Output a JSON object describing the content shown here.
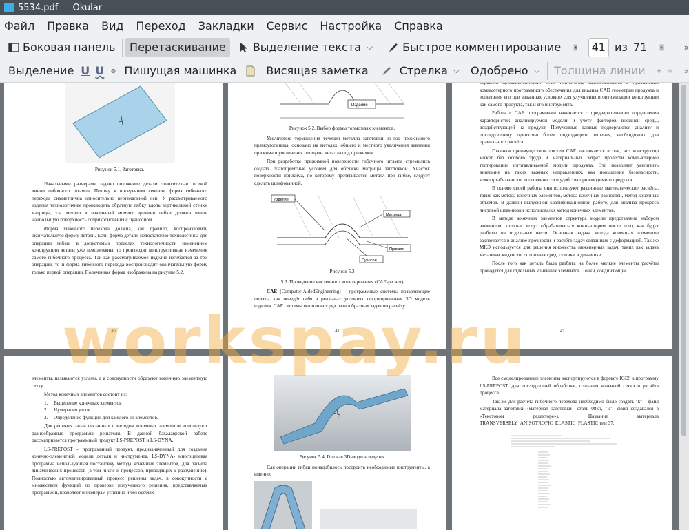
{
  "window": {
    "title": "5534.pdf  — Okular"
  },
  "menu": [
    "Файл",
    "Правка",
    "Вид",
    "Переход",
    "Закладки",
    "Сервис",
    "Настройка",
    "Справка"
  ],
  "toolbar1": {
    "sidebar": "Боковая панель",
    "drag": "Перетаскивание",
    "select_text": "Выделение текста",
    "quick_comment": "Быстрое комментирование",
    "page_current": "41",
    "page_of": "из",
    "page_total": "71"
  },
  "toolbar2": {
    "highlight": "Выделение",
    "typewriter": "Пишущая машинка",
    "sticky_note": "Висящая заметка",
    "arrow": "Стрелка",
    "approved": "Одобрено",
    "line_width": "Толщина линии"
  },
  "watermark": "worksрay.ru",
  "pages": {
    "p40": {
      "caption": "Рисунок 5.1. Заготовка.",
      "paragraphs": [
        "Начальными размерами задано положение детали относительно осевой линии гибочного штампа. Потому в поперечном сечении форма гибочного перехода симметрична относительно вертикальной оси. У рассматриваемого изделия технологичнее производить обратную гибку вдоль вертикальной стенки матрицы, т.к. металл в начальный момент времени гибки должен иметь наибольшую поверхность соприкосновения с пуансоном.",
        "Форма гибочного перехода должна, как правило, воспроизводить окончательную форму детали. Если форма детали недостаточно технологична для операции гибки, в допустимых пределах технологичности изменением конструкции детали уже невозможны, то производят конструктивные изменения самого гибочного процесса. Так как рассматриваемое изделие изгибается за три операции, то и форма гибочного перехода воспроизводит окончательную форму только первой операции. Полученная форма изображена на рисунке 5.2."
      ],
      "number": "40"
    },
    "p41": {
      "label_top": "Изделие",
      "caption1": "Рисунок 5.2. Выбор формы тормозных элементов.",
      "paragraphs": [
        "Увеличение торможения течения металла заготовки из-под прижимного прямоугольника, основано на методах: общего и местного увеличения давления прижима и увеличения площади металла под прижимом.",
        "При разработке прижимной поверхности гибочного штампа стремились создать благоприятные условия для обтяжки матрицы заготовкой. Участок поверхности прижима, по которому протягивается металл при гибке, следует сделать шлифованной."
      ],
      "labels": {
        "a": "Изделие",
        "b": "Матрица",
        "c": "Прижим",
        "d": "Пуансон"
      },
      "caption2": "Рисунок 5.3",
      "heading": "5.3. Проведение численного моделирования (CAE-расчет)",
      "cae_term": "CAE",
      "cae_text": "(Computer-AidedEngineering) – программные системы позволяющие понять, как поведёт себя в реальных условиях сформированная 3D модель изделия. CAE системы выполняют ряд разнообразных задач по расчёту",
      "number": "41"
    },
    "p42": {
      "paragraphs": [
        "отраслях промышленности. CAE технология, заключающаяся в применении компьютерного программного обеспечения для анализа CAD геометрии продукта и испытания его при заданных условиях для улучшения и оптимизации конструкции как самого продукта, так и его инструмента.",
        "Работа с CAE программами начинается с предварительного определения характеристик анализируемой модели и учёту факторов внешней среды, воздействующей на продукт. Полученные данные подвергаются анализу и последующему принятию более подходящего решения, необходимого для правильного расчёта.",
        "Главным преимуществом систем CAE заключается в том, что конструктор может без особого труда и материальных затрат провести компьютерное тестирование изготавливаемой модели продукта. Это позволяет увеличить внимание на таких важных направлениях, как повышение безопасности, комфортабельности, долговечности и удобства производимого продукта.",
        "В основе своей работы они используют различные математические расчёты, такие как метода конечных элементов, метода конечных разностей, метод конечных объёмов. В данной выпускной квалификационной работе, для анализа процесса листовой штамповки использовался метод конечных элементов.",
        "В методе конечных элементов структура модели представлена набором элементов, которые могут обрабатываться компьютером после того, как будут разбиты на отдельные части. Основная задача метода конечных элементов заключается в анализе прочности и расчёте задач связанных с деформацией. Так же МКЭ используется для решения множества инженерных задач, таких как задача механики жидкости, сплошных сред, статики и динамики.",
        "После того как деталь была разбита на более мелкие элементы расчёты проводятся для отдельных конечных элементов. Точки, соединяющие"
      ],
      "number": "42"
    },
    "p43": {
      "paragraphs": [
        "элементы, называются узлами, а а совокупности образуют конечную элементную сетку.",
        "Метод конечных элементов состоит из:"
      ],
      "list": [
        "Выделение конечных элементов",
        "Нумерация узлов",
        "Определение функций для каждого из элементов."
      ],
      "list_nums": [
        "1.",
        "2.",
        "3."
      ],
      "paragraphs2": [
        "Для решения задач связанных с методом конечных элементов используют разнообразные программы решатели. В данной бакалаврской работе рассматривается программный продукт LS-PREPOST и LS-DYNA.",
        "LS-PREPOST – программный продукт, предназначенный для создания конечно-элементной модели детали и инструмента. LS-DYNA- многоцелевая программа использующая постановку метода конечных элементов, для расчёта динамических процессов (в том числе и процессов, приводящих к разрушению). Полностью автоматизированный процесс решения задач, в совокупности с множеством функций по проверке полученного решения, представляемых программой, позволяет инженерам успешно и без особых"
      ]
    },
    "p44": {
      "caption": "Рисунок 5.4. Готовая 3D-модель изделия",
      "paragraph": "Для операции гибки понадобилось построить необходимые инструменты, а именно:"
    },
    "p45": {
      "paragraphs": [
        "Все смоделированные элементы экспортируются в формате IGES в программу LS-PREPOST, для последующей обработки, создания конечной сетки и расчёта процесса.",
        "Так же для расчёта гибочного перехода необходимо было создать \"k\" – файл материала заготовки (материал заготовки –сталь 08кп, \"k\" –файл создавался в «Текстовом редакторе»). Название материала TRANSVERSELY_ANISOTROPIC_ELASTIC_PLASTIC тип 37."
      ]
    }
  },
  "colors": {
    "accent": "#3daee9",
    "titlebar": "#475057",
    "watermark": "#f0aa3c"
  }
}
